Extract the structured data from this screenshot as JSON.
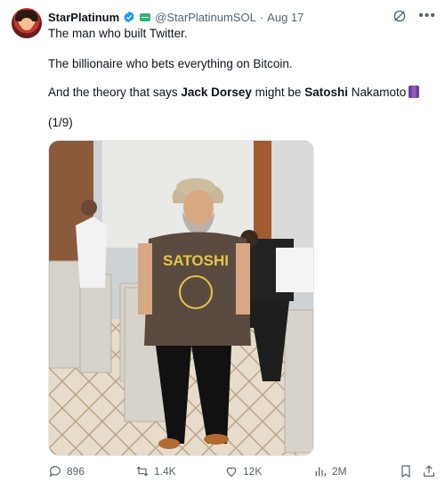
{
  "author": {
    "name": "StarPlatinum",
    "handle": "@StarPlatinumSOL",
    "separator": "·",
    "date": "Aug 17"
  },
  "tweet": {
    "line1": "The man who built Twitter.",
    "line2": "The billionaire who bets everything on Bitcoin.",
    "line3_a": "And the theory that says ",
    "line3_b": "Jack Dorsey",
    "line3_c": " might be ",
    "line3_d": "Satoshi",
    "line3_e": " Nakamoto",
    "thread_count": "(1/9)"
  },
  "photo": {
    "shirt_text": "SATOSHI"
  },
  "actions": {
    "replies": "896",
    "reposts": "1.4K",
    "likes": "12K",
    "views": "2M"
  },
  "colors": {
    "verified": "#1d9bf0",
    "text": "#0f1419",
    "muted": "#536471"
  }
}
